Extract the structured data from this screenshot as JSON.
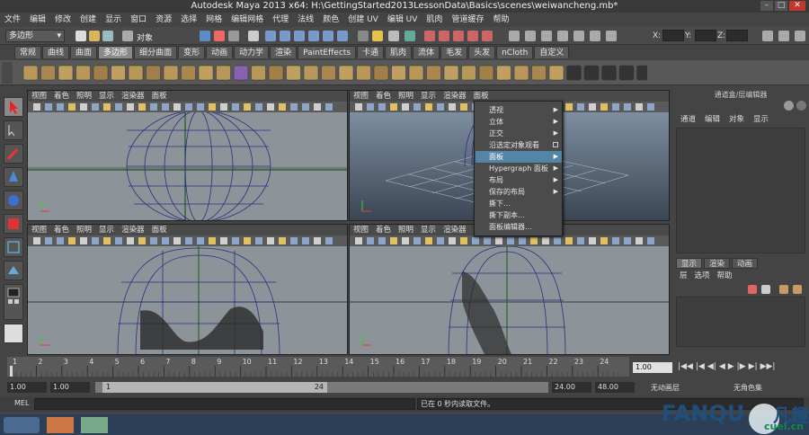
{
  "title": "Autodesk Maya 2013 x64: H:\\GettingStarted2013LessonData\\Basics\\scenes\\weiwancheng.mb*",
  "menubar": [
    "文件",
    "编辑",
    "修改",
    "创建",
    "显示",
    "窗口",
    "资源",
    "选择",
    "网格",
    "编辑网格",
    "代理",
    "法线",
    "颜色",
    "创建 UV",
    "编辑 UV",
    "肌肉",
    "管道缓存",
    "帮助"
  ],
  "statusline": {
    "mode_select": "多边形",
    "object_label": "对象",
    "x_label": "X:",
    "y_label": "Y:",
    "z_label": "Z:"
  },
  "shelf_tabs": [
    {
      "label": "常规",
      "active": false
    },
    {
      "label": "曲线",
      "active": false
    },
    {
      "label": "曲面",
      "active": false
    },
    {
      "label": "多边形",
      "active": true
    },
    {
      "label": "细分曲面",
      "active": false
    },
    {
      "label": "变形",
      "active": false
    },
    {
      "label": "动画",
      "active": false
    },
    {
      "label": "动力学",
      "active": false
    },
    {
      "label": "渲染",
      "active": false
    },
    {
      "label": "PaintEffects",
      "active": false
    },
    {
      "label": "卡通",
      "active": false
    },
    {
      "label": "肌肉",
      "active": false
    },
    {
      "label": "流体",
      "active": false
    },
    {
      "label": "毛发",
      "active": false
    },
    {
      "label": "头发",
      "active": false
    },
    {
      "label": "nCloth",
      "active": false
    },
    {
      "label": "自定义",
      "active": false
    }
  ],
  "pane_menu": [
    "视图",
    "着色",
    "照明",
    "显示",
    "渲染器",
    "面板"
  ],
  "context_menu": [
    {
      "label": "透视",
      "submenu": true
    },
    {
      "label": "立体",
      "submenu": true
    },
    {
      "label": "正交",
      "submenu": true
    },
    {
      "label": "沿选定对象观看",
      "option": true
    },
    {
      "label": "面板",
      "submenu": true,
      "highlight": true
    },
    {
      "label": "Hypergraph 面板",
      "submenu": true
    },
    {
      "label": "布局",
      "submenu": true
    },
    {
      "label": "保存的布局",
      "submenu": true
    },
    {
      "label": "撕下...",
      "submenu": false
    },
    {
      "label": "撕下副本...",
      "submenu": false
    },
    {
      "label": "面板编辑器...",
      "submenu": false
    }
  ],
  "channel_box": {
    "title": "通道盒/层编辑器",
    "menu": [
      "通道",
      "编辑",
      "对象",
      "显示"
    ]
  },
  "layer_editor": {
    "tabs": [
      {
        "label": "显示",
        "active": true
      },
      {
        "label": "渲染",
        "active": false
      },
      {
        "label": "动画",
        "active": false
      }
    ],
    "menu": [
      "层",
      "选项",
      "帮助"
    ]
  },
  "timeline": {
    "ticks": [
      1,
      2,
      3,
      4,
      5,
      6,
      7,
      8,
      9,
      10,
      11,
      12,
      13,
      14,
      15,
      16,
      17,
      18,
      19,
      20,
      21,
      22,
      23,
      24
    ],
    "current_frame": "1.00"
  },
  "range": {
    "start": "1.00",
    "start2": "1.00",
    "range_start_label": "1",
    "range_end_label": "24",
    "end": "24.00",
    "end2": "48.00",
    "anim_layer": "无动画层",
    "char_set": "无角色集"
  },
  "cmdline": {
    "label": "MEL",
    "result": "已在 0 秒内读取文件。"
  },
  "watermark": {
    "brand": "FANQU",
    "brand_cn": "凡趣",
    "site": "cuel.cn"
  }
}
